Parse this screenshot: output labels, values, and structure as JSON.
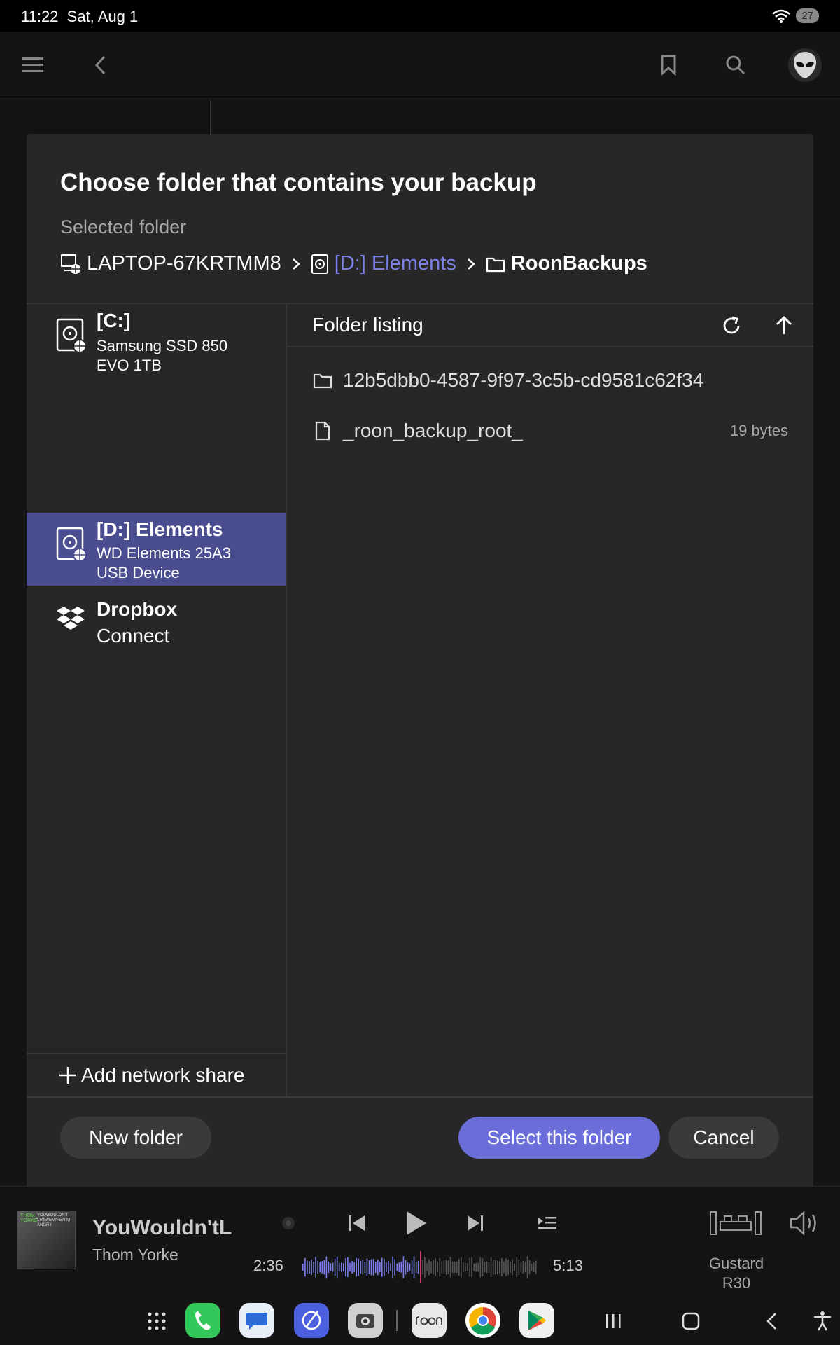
{
  "status_bar": {
    "time": "11:22",
    "date": "Sat, Aug 1",
    "battery": "27"
  },
  "dialog": {
    "title": "Choose folder that contains your backup",
    "selected_label": "Selected folder",
    "breadcrumb": [
      {
        "label": "LAPTOP-67KRTMM8",
        "icon": "computer-icon"
      },
      {
        "label": "[D:] Elements",
        "icon": "drive-icon"
      },
      {
        "label": "RoonBackups",
        "icon": "folder-icon"
      }
    ],
    "drives": [
      {
        "name": "[C:]",
        "sub1": "Samsung SSD 850",
        "sub2": "EVO 1TB",
        "icon": "hard-drive-icon"
      },
      {
        "name": "[D:] Elements",
        "sub1": "WD Elements 25A3",
        "sub2": "USB Device",
        "icon": "hard-drive-icon",
        "selected": true
      },
      {
        "name": "Dropbox",
        "action": "Connect",
        "icon": "dropbox-icon"
      }
    ],
    "add_share_label": "Add network share",
    "listing": {
      "title": "Folder listing",
      "items": [
        {
          "name": "12b5dbb0-4587-9f97-3c5b-cd9581c62f34",
          "type": "folder",
          "size": ""
        },
        {
          "name": "_roon_backup_root_",
          "type": "file",
          "size": "19 bytes"
        }
      ]
    },
    "buttons": {
      "new_folder": "New folder",
      "select": "Select this folder",
      "cancel": "Cancel"
    }
  },
  "player": {
    "album_art_text_1": "THOM\nYORKE",
    "album_art_text_2": "YOUWOULDN'T\nLIKEMEWHENIM\nANGRY",
    "track_title": "YouWouldn'tLi",
    "artist": "Thom Yorke",
    "elapsed": "2:36",
    "total": "5:13",
    "progress": 0.5,
    "zone_line1": "Gustard",
    "zone_line2": "R30"
  },
  "colors": {
    "accent": "#7b7fe6",
    "selected_row": "#4a4d8f",
    "button_primary": "#6b6ed8"
  }
}
